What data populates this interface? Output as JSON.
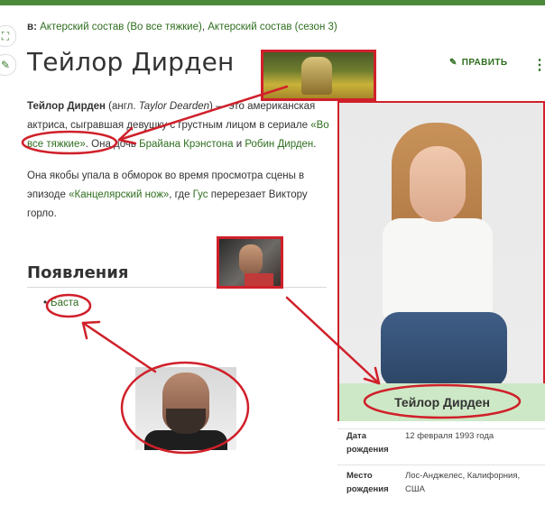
{
  "header": {
    "categories_prefix": "в:",
    "category_1": "Актерский состав (Во все тяжкие)",
    "category_sep": ", ",
    "category_2": "Актерский состав (сезон 3)",
    "page_title": "Тейлор Дирден",
    "edit_label": "ПРАВИТЬ",
    "more_label": "⋮"
  },
  "article": {
    "p1": {
      "name_bold": "Тейлор Дирден",
      "t1": " (англ. ",
      "eng_name": "Taylor Dearden",
      "t2": ") — это американская актриса, сыгравшая девушку с грустным лицом в сериале ",
      "link_show": "«Во все тяжкие»",
      "t3": ". Она дочь ",
      "link_father": "Брайана Крэнстона",
      "t4": " и ",
      "link_mother": "Робин Дирден",
      "t5": "."
    },
    "p2": {
      "t1": "Она якобы упала в обморок во время просмотра сцены в эпизоде ",
      "link_episode": "«Канцелярский нож»",
      "t2": ", где ",
      "link_gus": "Гус",
      "t3": " перерезает Виктору горло."
    },
    "section_title": "Появления",
    "appearances": [
      "Баста"
    ]
  },
  "infobox": {
    "title": "Тейлор Дирден",
    "rows": [
      {
        "label": "Дата рождения",
        "value": "12 февраля 1993 года"
      },
      {
        "label": "Место рождения",
        "value": "Лос-Анджелес, Калифорния, США"
      }
    ]
  },
  "icons": {
    "rail_top": "expand-icon",
    "rail_bottom": "edit-pencil-icon",
    "edit": "pencil-icon",
    "more": "kebab-menu-icon"
  },
  "colors": {
    "accent": "#2f6e1f",
    "annotation": "#d0202a",
    "infobox_header": "#cde8c6"
  }
}
